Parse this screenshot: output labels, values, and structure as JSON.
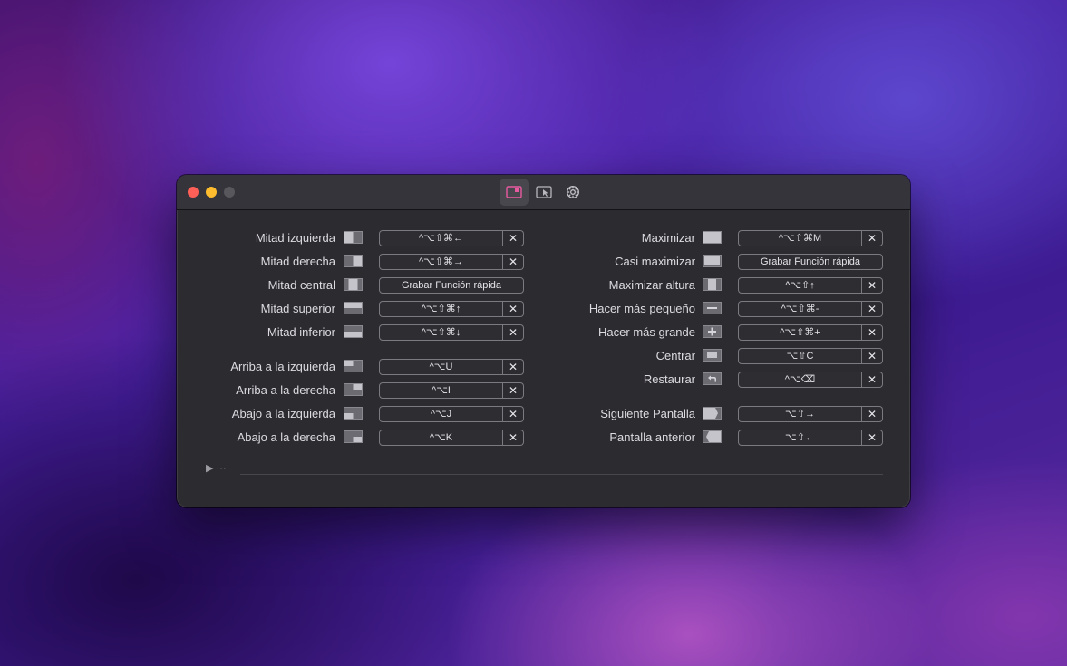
{
  "window": {
    "toolbar": [
      "shortcuts-tab",
      "snap-areas-tab",
      "settings-tab"
    ]
  },
  "left_rows": [
    {
      "label": "Mitad izquierda",
      "shortcut": "^⌥⇧⌘←",
      "icon": "left-half-icon",
      "clear": "✕"
    },
    {
      "label": "Mitad derecha",
      "shortcut": "^⌥⇧⌘→",
      "icon": "right-half-icon",
      "clear": "✕"
    },
    {
      "label": "Mitad central",
      "shortcut": "Grabar Función rápida",
      "icon": "center-half-icon",
      "clear": ""
    },
    {
      "label": "Mitad superior",
      "shortcut": "^⌥⇧⌘↑",
      "icon": "top-half-icon",
      "clear": "✕"
    },
    {
      "label": "Mitad inferior",
      "shortcut": "^⌥⇧⌘↓",
      "icon": "bottom-half-icon",
      "clear": "✕"
    },
    {
      "label": "Arriba a la izquierda",
      "shortcut": "^⌥U",
      "icon": "top-left-icon",
      "clear": "✕"
    },
    {
      "label": "Arriba a la derecha",
      "shortcut": "^⌥I",
      "icon": "top-right-icon",
      "clear": "✕"
    },
    {
      "label": "Abajo a la izquierda",
      "shortcut": "^⌥J",
      "icon": "bottom-left-icon",
      "clear": "✕"
    },
    {
      "label": "Abajo a la derecha",
      "shortcut": "^⌥K",
      "icon": "bottom-right-icon",
      "clear": "✕"
    }
  ],
  "right_rows": [
    {
      "label": "Maximizar",
      "shortcut": "^⌥⇧⌘M",
      "icon": "maximize-icon",
      "clear": "✕"
    },
    {
      "label": "Casi maximizar",
      "shortcut": "Grabar Función rápida",
      "icon": "almost-maximize-icon",
      "clear": ""
    },
    {
      "label": "Maximizar altura",
      "shortcut": "^⌥⇧↑",
      "icon": "maximize-height-icon",
      "clear": "✕"
    },
    {
      "label": "Hacer más pequeño",
      "shortcut": "^⌥⇧⌘-",
      "icon": "make-smaller-icon",
      "clear": "✕"
    },
    {
      "label": "Hacer más grande",
      "shortcut": "^⌥⇧⌘+",
      "icon": "make-larger-icon",
      "clear": "✕"
    },
    {
      "label": "Centrar",
      "shortcut": "⌥⇧C",
      "icon": "center-icon",
      "clear": "✕"
    },
    {
      "label": "Restaurar",
      "shortcut": "^⌥⌫",
      "icon": "restore-icon",
      "clear": "✕"
    },
    {
      "label": "Siguiente Pantalla",
      "shortcut": "⌥⇧→",
      "icon": "next-display-icon",
      "clear": "✕"
    },
    {
      "label": "Pantalla anterior",
      "shortcut": "⌥⇧←",
      "icon": "previous-display-icon",
      "clear": "✕"
    }
  ],
  "footer": {
    "toggle": "▶ ⋯"
  },
  "colors": {
    "accent": "#e85aa0",
    "traffic_close": "#fe5f57",
    "traffic_min": "#febc2e"
  }
}
